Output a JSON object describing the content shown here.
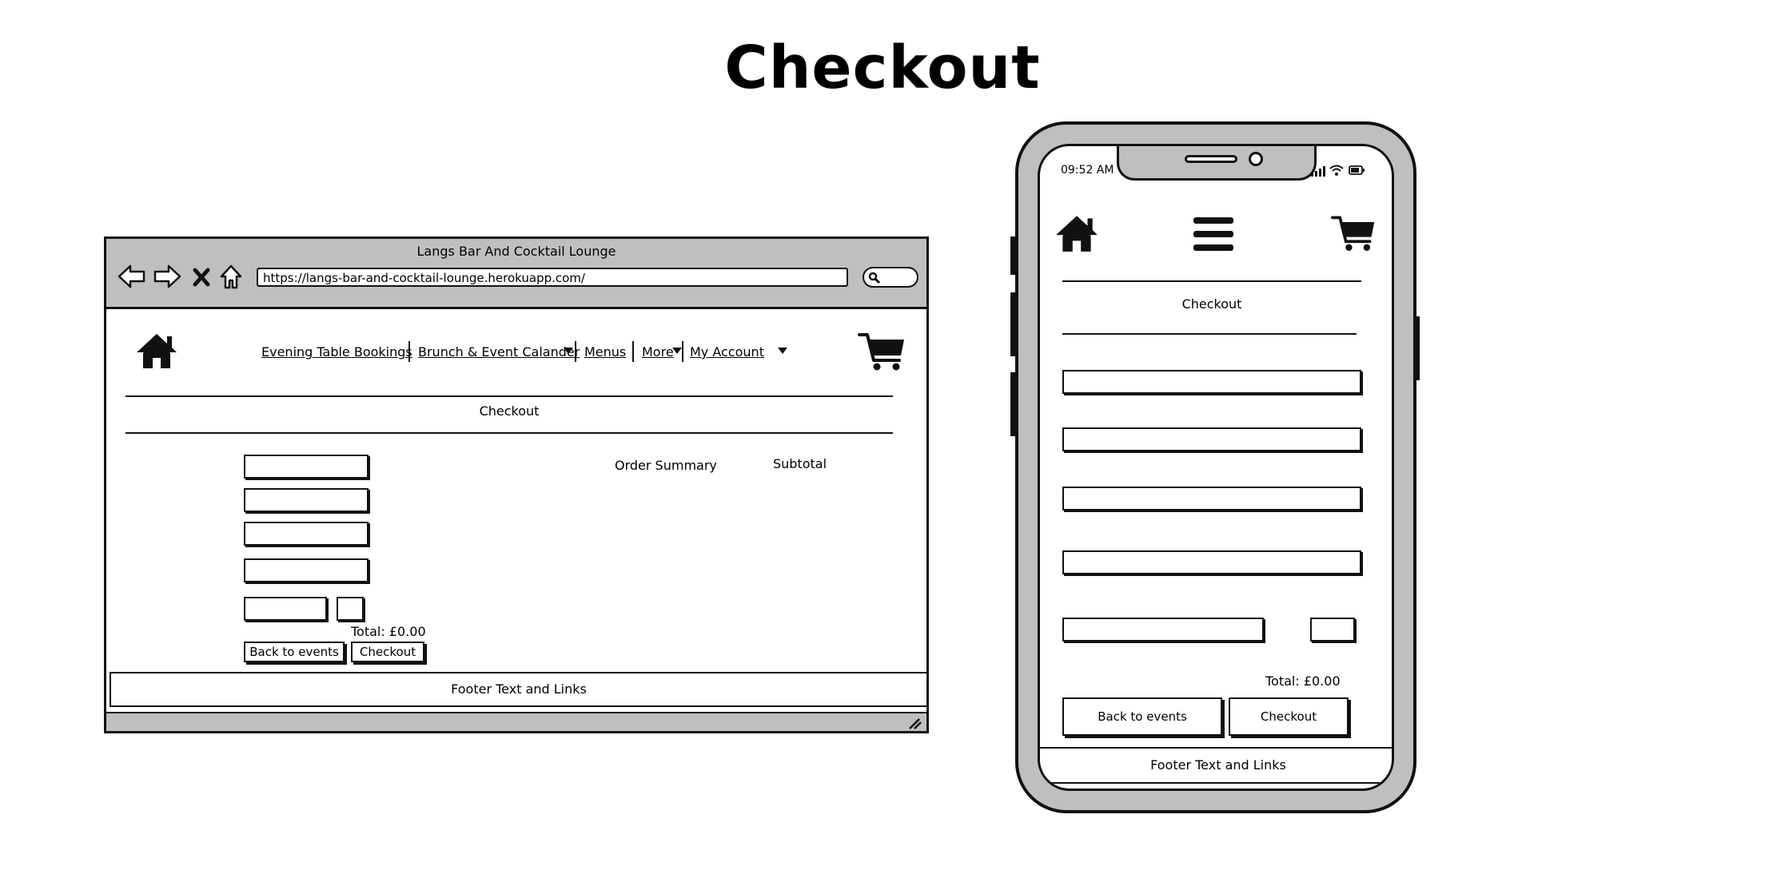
{
  "page": {
    "title": "Checkout"
  },
  "desktop": {
    "window_title": "Langs Bar And Cocktail Lounge",
    "url": "https://langs-bar-and-cocktail-lounge.herokuapp.com/",
    "nav": {
      "evening": "Evening Table Bookings",
      "brunch": "Brunch & Event Calander",
      "menus": "Menus",
      "more": "More",
      "account": "My Account"
    },
    "section_title": "Checkout",
    "order_summary": "Order Summary",
    "subtotal": "Subtotal",
    "total": "Total: £0.00",
    "back_button": "Back to events",
    "checkout_button": "Checkout",
    "footer": "Footer Text and Links"
  },
  "mobile": {
    "time": "09:52 AM",
    "section_title": "Checkout",
    "total": "Total: £0.00",
    "back_button": "Back to events",
    "checkout_button": "Checkout",
    "footer": "Footer Text and Links"
  },
  "icons": {
    "back": "arrow-left-icon",
    "forward": "arrow-right-icon",
    "stop": "close-icon",
    "home": "home-icon",
    "search": "search-icon",
    "cart": "shopping-cart-icon",
    "menu": "hamburger-menu-icon",
    "signal": "signal-icon",
    "wifi": "wifi-icon",
    "battery": "battery-icon",
    "resize": "resize-grip-icon"
  }
}
